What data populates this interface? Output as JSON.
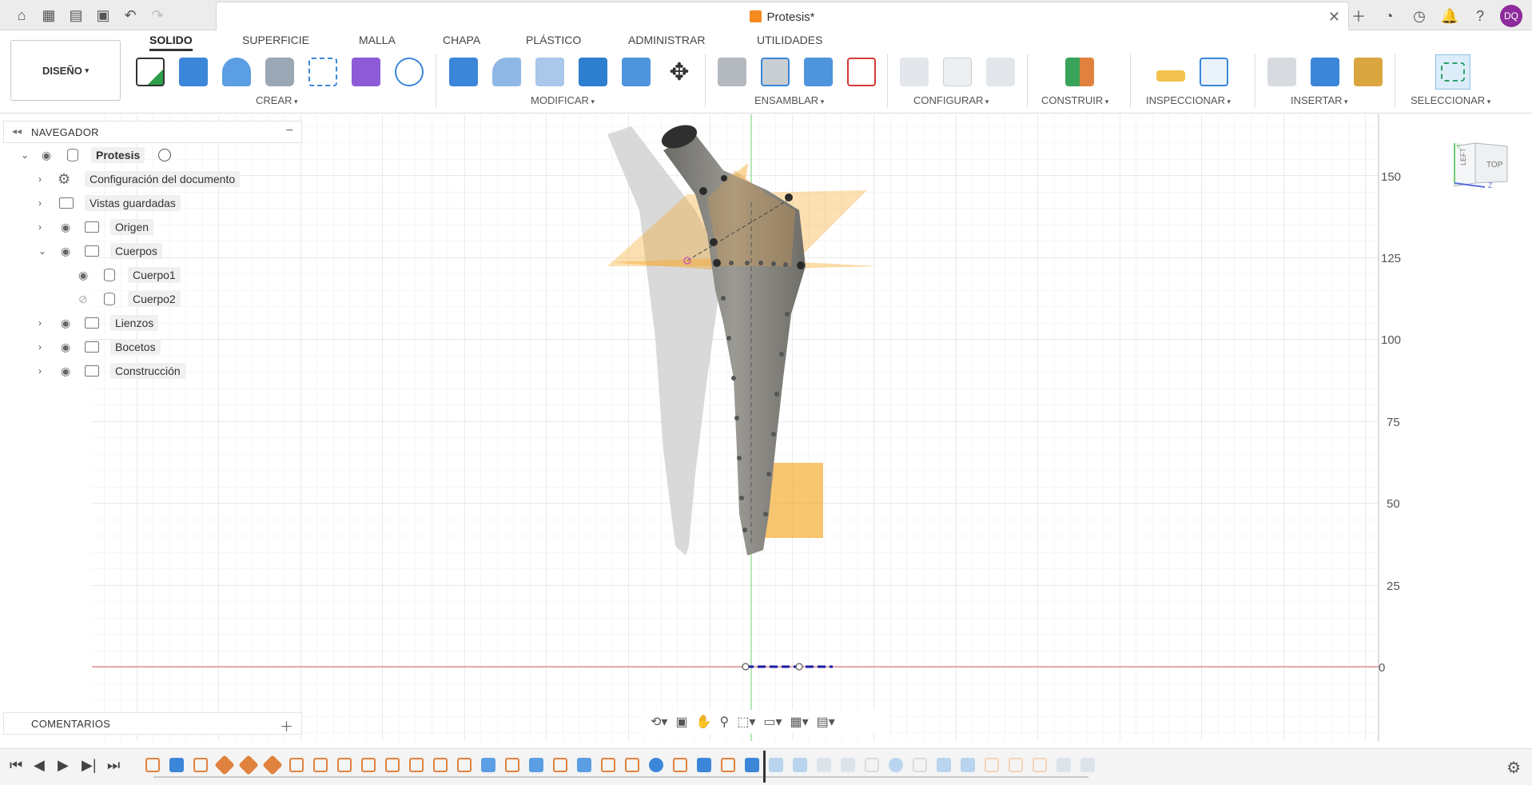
{
  "window": {
    "doc_title": "Protesis*",
    "avatar": "DQ"
  },
  "toolbar": {
    "workspace": "DISEÑO",
    "tabs": [
      "SOLIDO",
      "SUPERFICIE",
      "MALLA",
      "CHAPA",
      "PLÁSTICO",
      "ADMINISTRAR",
      "UTILIDADES"
    ],
    "active_tab": "SOLIDO",
    "groups": [
      "CREAR",
      "MODIFICAR",
      "ENSAMBLAR",
      "CONFIGURAR",
      "CONSTRUIR",
      "INSPECCIONAR",
      "INSERTAR",
      "SELECCIONAR"
    ]
  },
  "navigator": {
    "title": "NAVEGADOR",
    "root": "Protesis",
    "items": [
      {
        "label": "Configuración del documento",
        "icon": "gear-icon"
      },
      {
        "label": "Vistas guardadas",
        "icon": "folder-icon"
      },
      {
        "label": "Origen",
        "icon": "folder-icon"
      },
      {
        "label": "Cuerpos",
        "icon": "folder-icon"
      },
      {
        "label": "Cuerpo1",
        "icon": "body-icon"
      },
      {
        "label": "Cuerpo2",
        "icon": "body-icon"
      },
      {
        "label": "Lienzos",
        "icon": "folder-icon"
      },
      {
        "label": "Bocetos",
        "icon": "folder-icon"
      },
      {
        "label": "Construcción",
        "icon": "folder-icon"
      }
    ]
  },
  "comments": {
    "title": "COMENTARIOS"
  },
  "ruler": {
    "ticks": [
      "150",
      "125",
      "100",
      "75",
      "50",
      "25",
      "0"
    ]
  },
  "viewcube": {
    "left": "LEFT",
    "top": "TOP",
    "axis_y": "Y",
    "axis_z": "Z"
  },
  "colors": {
    "accent": "#0696d7",
    "avatar": "#8e2b9c",
    "sketch_plane": "#f5a623",
    "axis_red": "#e06666",
    "axis_green": "#6fcf6f"
  }
}
